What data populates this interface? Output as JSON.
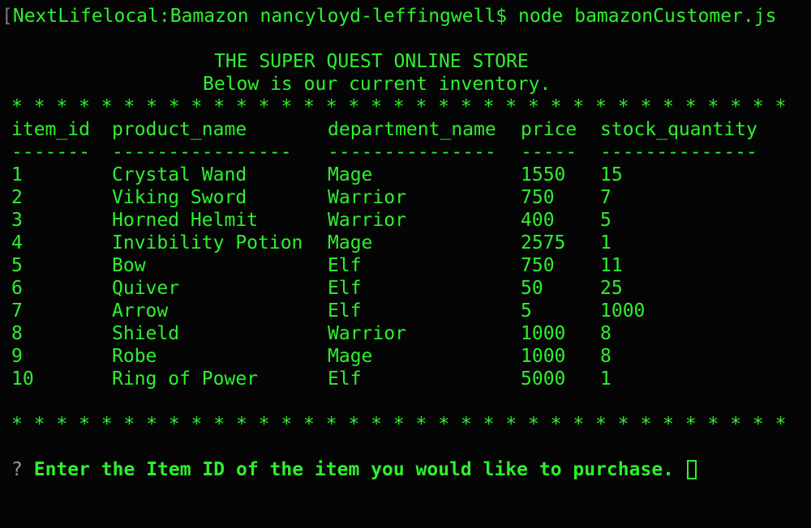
{
  "terminal": {
    "prompt_bracket": "[",
    "prompt": "NextLifelocal:Bamazon nancyloyd-leffingwell$ node bamazonCustomer.js",
    "store_title": "THE SUPER QUEST ONLINE STORE",
    "store_subtitle": "Below is our current inventory.",
    "divider": "* * * * * * * * * * * * * * * * * * * * * * * * * * * * * * * * * * *",
    "question_mark": "?",
    "question": "Enter the Item ID of the item you would like to purchase."
  },
  "table": {
    "headers": [
      "item_id",
      "product_name",
      "department_name",
      "price",
      "stock_quantity"
    ],
    "separators": [
      "-------",
      "----------------",
      "---------------",
      "-----",
      "--------------"
    ],
    "rows": [
      [
        "1",
        "Crystal Wand",
        "Mage",
        "1550",
        "15"
      ],
      [
        "2",
        "Viking Sword",
        "Warrior",
        "750",
        "7"
      ],
      [
        "3",
        "Horned Helmit",
        "Warrior",
        "400",
        "5"
      ],
      [
        "4",
        "Invibility Potion",
        "Mage",
        "2575",
        "1"
      ],
      [
        "5",
        "Bow",
        "Elf",
        "750",
        "11"
      ],
      [
        "6",
        "Quiver",
        "Elf",
        "50",
        "25"
      ],
      [
        "7",
        "Arrow",
        "Elf",
        "5",
        "1000"
      ],
      [
        "8",
        "Shield",
        "Warrior",
        "1000",
        "8"
      ],
      [
        "9",
        "Robe",
        "Mage",
        "1000",
        "8"
      ],
      [
        "10",
        "Ring of Power",
        "Elf",
        "5000",
        "1"
      ]
    ]
  },
  "colors": {
    "text": "#2ef02e",
    "background": "#050505",
    "muted": "#7a7a7a"
  },
  "icons": {
    "cursor": "block-cursor-icon"
  }
}
